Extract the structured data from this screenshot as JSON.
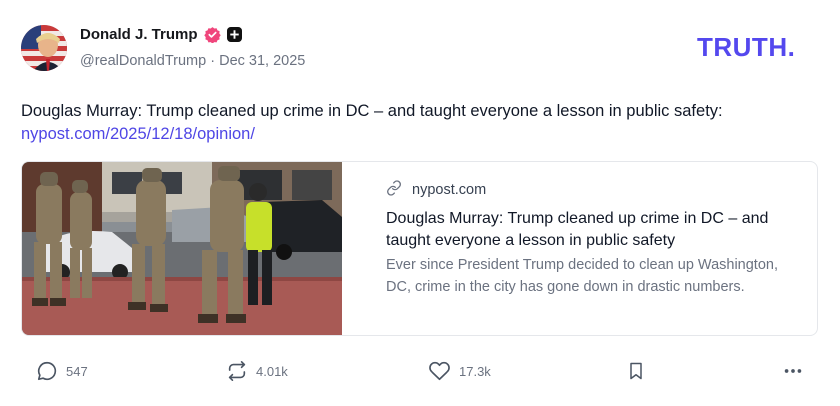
{
  "author": {
    "display_name": "Donald J. Trump",
    "handle": "@realDonaldTrump",
    "separator": "·",
    "date": "Dec 31, 2025"
  },
  "brand": {
    "logo_text": "TRUTH.",
    "accent": "#5448ee"
  },
  "post": {
    "text": "Douglas Murray: Trump cleaned up crime in DC – and taught everyone a lesson in public safety:",
    "link": "nypost.com/2025/12/18/opinion/"
  },
  "link_card": {
    "domain": "nypost.com",
    "title": "Douglas Murray: Trump cleaned up crime in DC – and taught everyone a lesson in public safety",
    "description": "Ever since President Trump decided to clean up Washington, DC, crime in the city has gone down in drastic numbers."
  },
  "actions": {
    "replies": "547",
    "retruths": "4.01k",
    "likes": "17.3k"
  },
  "icons": [
    "verified-icon",
    "plus-badge-icon",
    "link-icon",
    "reply-icon",
    "retruth-icon",
    "like-icon",
    "bookmark-icon",
    "more-icon"
  ],
  "colors": {
    "verified": "#f0467c",
    "link": "#4f46e5",
    "muted": "#6b7280"
  }
}
